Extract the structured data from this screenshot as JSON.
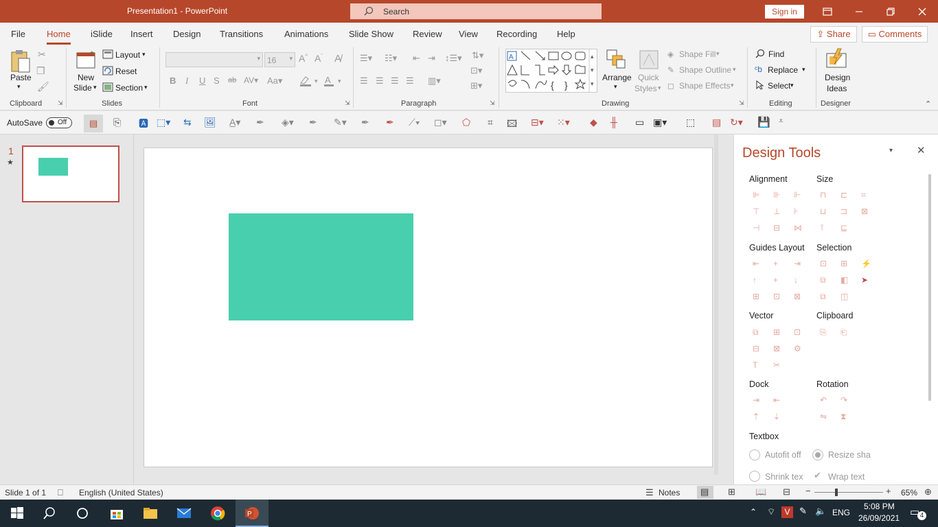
{
  "window": {
    "title": "Presentation1  -  PowerPoint",
    "search_placeholder": "Search",
    "sign_in": "Sign in"
  },
  "menu": {
    "tabs": [
      "File",
      "Home",
      "iSlide",
      "Insert",
      "Design",
      "Transitions",
      "Animations",
      "Slide Show",
      "Review",
      "View",
      "Recording",
      "Help"
    ],
    "active_tab": "Home",
    "share": "Share",
    "comments": "Comments"
  },
  "ribbon": {
    "clipboard": {
      "label": "Clipboard",
      "paste": "Paste"
    },
    "slides": {
      "label": "Slides",
      "new_slide_line1": "New",
      "new_slide_line2": "Slide",
      "layout": "Layout",
      "reset": "Reset",
      "section": "Section"
    },
    "font": {
      "label": "Font",
      "font_size": "16"
    },
    "paragraph": {
      "label": "Paragraph"
    },
    "drawing": {
      "label": "Drawing",
      "arrange": "Arrange",
      "quick_styles_line1": "Quick",
      "quick_styles_line2": "Styles",
      "shape_fill": "Shape Fill",
      "shape_outline": "Shape Outline",
      "shape_effects": "Shape Effects"
    },
    "editing": {
      "label": "Editing",
      "find": "Find",
      "replace": "Replace",
      "select": "Select"
    },
    "designer": {
      "label": "Designer",
      "design_ideas_line1": "Design",
      "design_ideas_line2": "Ideas"
    }
  },
  "qat": {
    "autosave": "AutoSave",
    "autosave_state": "Off"
  },
  "slides_panel": {
    "slide_number": "1",
    "star": "★"
  },
  "design_tools": {
    "title": "Design Tools",
    "sections": {
      "alignment": "Alignment",
      "size": "Size",
      "guides_layout": "Guides Layout",
      "selection": "Selection",
      "vector": "Vector",
      "clipboard": "Clipboard",
      "dock": "Dock",
      "rotation": "Rotation",
      "textbox": "Textbox"
    },
    "textbox_options": {
      "autofit": "Autofit off",
      "resize": "Resize sha",
      "shrink": "Shrink tex",
      "wrap": "Wrap text"
    }
  },
  "statusbar": {
    "slide_of": "Slide 1 of 1",
    "language": "English (United States)",
    "notes": "Notes",
    "zoom": "65%"
  },
  "taskbar": {
    "lang": "ENG",
    "time": "5:08 PM",
    "date": "26/09/2021",
    "notif_count": "4"
  },
  "colors": {
    "accent": "#b7472a",
    "shape_fill": "#48cfad",
    "selection_outline": "#c0504d"
  }
}
